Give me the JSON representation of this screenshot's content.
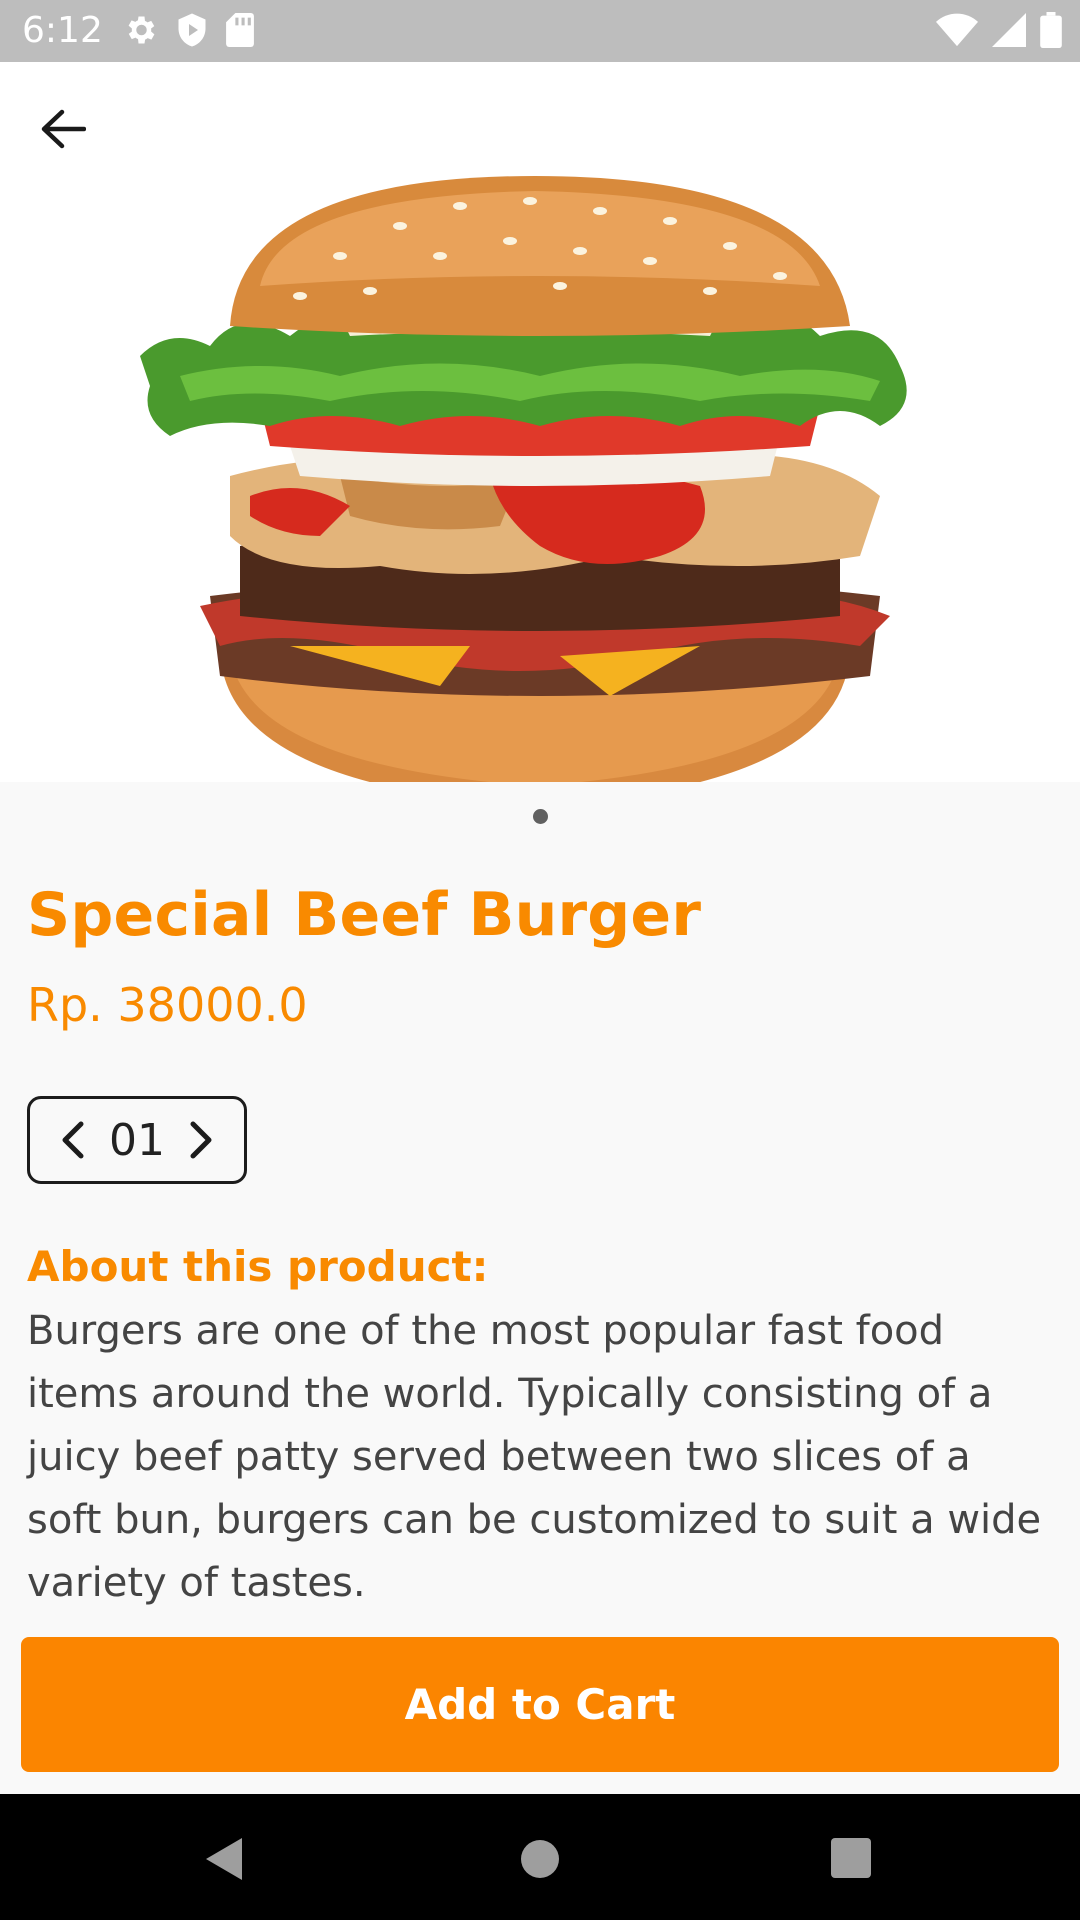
{
  "status_bar": {
    "time": "6:12",
    "icons": [
      "gear-icon",
      "shield-icon",
      "sd-card-icon",
      "wifi-icon",
      "signal-icon",
      "battery-icon"
    ]
  },
  "hero": {
    "image": "burger-image",
    "pager": {
      "current": 1,
      "total": 1
    }
  },
  "product": {
    "title": "Special Beef Burger",
    "price": "Rp. 38000.0",
    "quantity": "01",
    "about_heading": "About this product:",
    "about_text": "Burgers are one of the most popular fast food items around the world. Typically consisting of a juicy beef patty served between two slices of a soft bun, burgers can be customized to suit a wide variety of tastes."
  },
  "actions": {
    "add_to_cart": "Add to Cart"
  },
  "colors": {
    "accent": "#fb8500",
    "status_bar": "#bdbdbd",
    "nav_bar": "#000000"
  }
}
